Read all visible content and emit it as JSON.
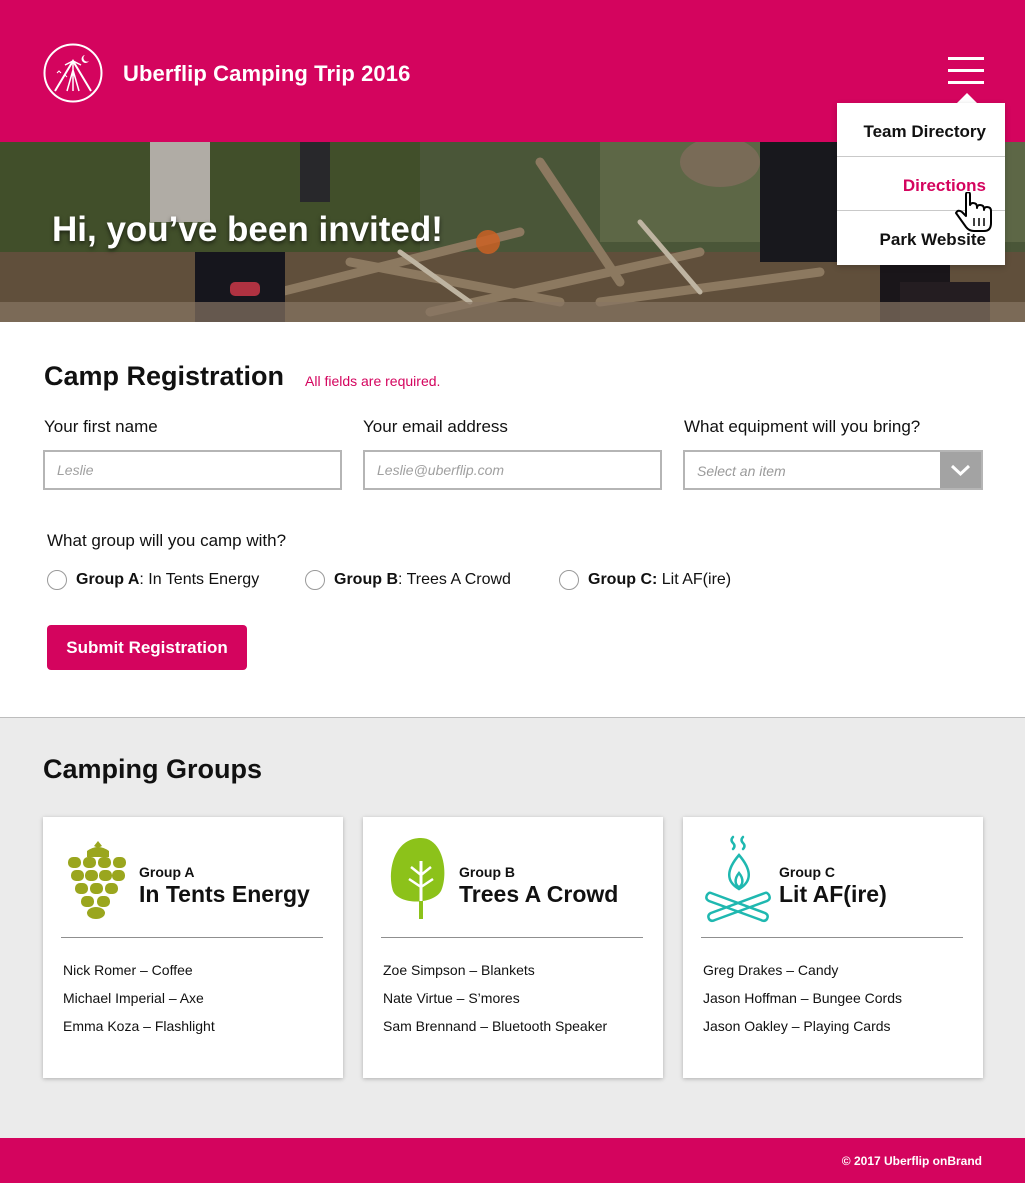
{
  "header": {
    "title": "Uberflip Camping Trip 2016",
    "brand_color": "#d4045e"
  },
  "nav_menu": {
    "items": [
      {
        "label": "Team Directory"
      },
      {
        "label": "Directions"
      },
      {
        "label": "Park Website"
      }
    ],
    "active_item": "Directions"
  },
  "hero": {
    "headline": "Hi, you’ve been invited!"
  },
  "registration": {
    "title": "Camp Registration",
    "required_note": "All fields are required.",
    "first_name": {
      "label": "Your first name",
      "placeholder": "Leslie"
    },
    "email": {
      "label": "Your email address",
      "placeholder": "Leslie@uberflip.com"
    },
    "equipment": {
      "label": "What equipment will you bring?",
      "selected": "Select an item"
    },
    "group_question": "What group will you camp with?",
    "group_options": [
      {
        "key": "Group A",
        "sep": ":",
        "name": " In Tents Energy"
      },
      {
        "key": "Group B",
        "sep": ":",
        "name": " Trees A Crowd"
      },
      {
        "key": "Group C:",
        "sep": "",
        "name": " Lit AF(ire)"
      }
    ],
    "submit_label": "Submit Registration"
  },
  "groups": {
    "title": "Camping Groups",
    "cards": [
      {
        "sub": "Group A",
        "name": "In Tents Energy",
        "icon": "pinecone-icon",
        "icon_color": "#9aa61e",
        "members": [
          "Nick Romer – Coffee",
          "Michael Imperial – Axe",
          "Emma Koza – Flashlight"
        ]
      },
      {
        "sub": "Group B",
        "name": "Trees A Crowd",
        "icon": "tree-icon",
        "icon_color": "#8cc21a",
        "members": [
          "Zoe Simpson – Blankets",
          "Nate Virtue – S’mores",
          "Sam Brennand – Bluetooth Speaker"
        ]
      },
      {
        "sub": "Group C",
        "name": "Lit AF(ire)",
        "icon": "campfire-icon",
        "icon_color": "#1fb8b0",
        "members": [
          "Greg Drakes – Candy",
          "Jason Hoffman – Bungee Cords",
          "Jason Oakley – Playing Cards"
        ]
      }
    ]
  },
  "footer": {
    "copyright": "© 2017 Uberflip onBrand"
  }
}
